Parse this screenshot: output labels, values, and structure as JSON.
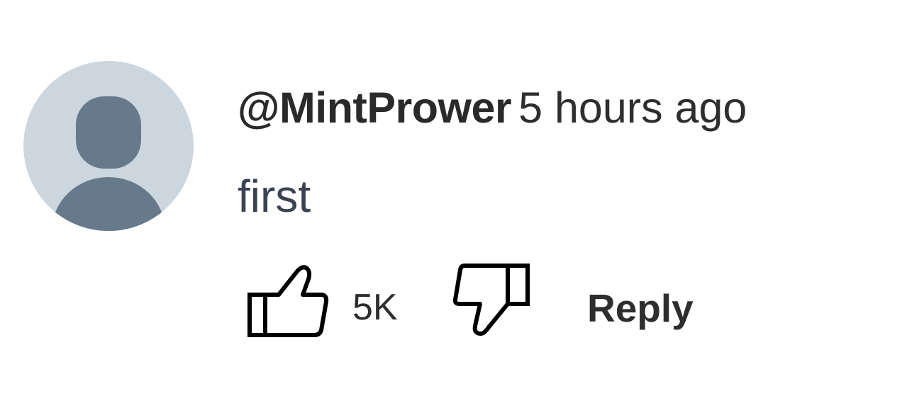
{
  "comment": {
    "author": "@MintPrower",
    "timestamp": "5 hours ago",
    "text": "first",
    "avatar_icon": "default-user-avatar-icon",
    "like_count": "5K",
    "reply_label": "Reply"
  },
  "icons": {
    "like": "thumb-up-icon",
    "dislike": "thumb-down-icon"
  },
  "colors": {
    "avatar_background": "#ccd6de",
    "avatar_figure": "#667a8c",
    "text": "#2e2e2e",
    "comment_text": "#3b4252"
  }
}
